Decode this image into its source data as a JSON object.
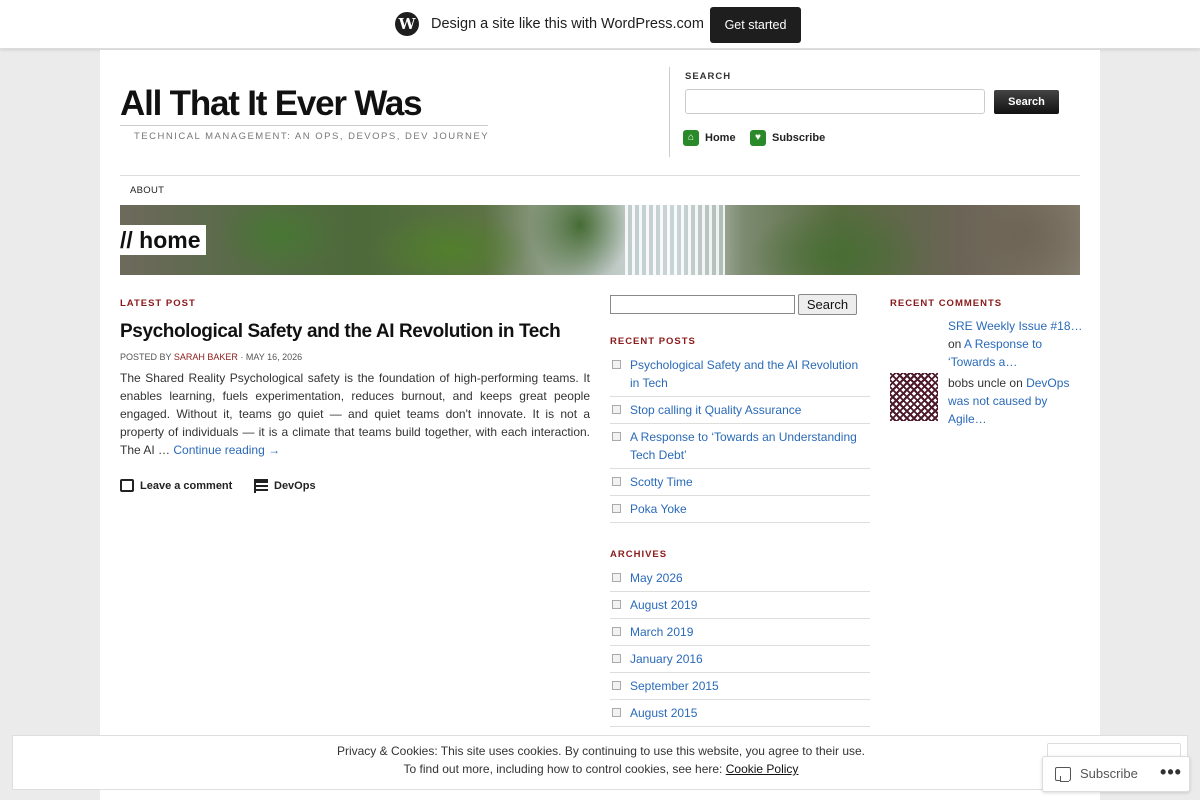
{
  "topbar": {
    "logo_glyph": "W",
    "promo_text": "Design a site like this with WordPress.com",
    "cta_label": "Get started"
  },
  "header": {
    "site_title": "All That It Ever Was",
    "tagline": "Technical Management: An Ops, DevOps, Dev Journey",
    "search_label": "SEARCH",
    "search_placeholder": "",
    "search_button": "Search",
    "quick_links": [
      {
        "label": "Home",
        "icon": "home-icon",
        "glyph": "⌂"
      },
      {
        "label": "Subscribe",
        "icon": "heart-icon",
        "glyph": "♥"
      }
    ]
  },
  "nav": {
    "items": [
      "ABOUT"
    ]
  },
  "banner": {
    "label": "// home"
  },
  "latest_post": {
    "section_label": "LATEST POST",
    "title": "Psychological Safety and the AI Revolution in Tech",
    "posted_by": "POSTED BY",
    "author": "SARAH BAKER",
    "date": "· MAY 16, 2026",
    "excerpt": "The Shared Reality Psychological safety is the foundation of high-performing teams. It enables learning, fuels experimentation, reduces burnout, and keeps great people engaged. Without it, teams go quiet — and quiet teams don't innovate. It is not a property of individuals — it is a climate that teams build together, with each interaction. The AI …",
    "continue_reading": "Continue reading →",
    "leave_comment": "Leave a comment",
    "category": "DevOps"
  },
  "sidebar_middle": {
    "search_placeholder": "",
    "search_button": "Search",
    "recent_posts_label": "RECENT POSTS",
    "recent_posts": [
      "Psychological Safety and the AI Revolution in Tech",
      "Stop calling it Quality Assurance",
      "A Response to ‘Towards an Understanding Tech Debt’",
      "Scotty Time",
      "Poka Yoke"
    ],
    "archives_label": "ARCHIVES",
    "archives": [
      "May 2026",
      "August 2019",
      "March 2019",
      "January 2016",
      "September 2015",
      "August 2015"
    ]
  },
  "sidebar_right": {
    "recent_comments_label": "RECENT COMMENTS",
    "comments": [
      {
        "author": "SRE Weekly Issue #18…",
        "on": "on",
        "post": "A Response to ‘Towards a…"
      },
      {
        "author": "bobs uncle",
        "on": "on",
        "post": "DevOps was not caused by Agile…"
      }
    ]
  },
  "cookie_banner": {
    "line1": "Privacy & Cookies: This site uses cookies. By continuing to use this website, you agree to their use.",
    "line2_prefix": "To find out more, including how to control cookies, see here:",
    "policy_link": "Cookie Policy"
  },
  "subscribe_bar": {
    "subscribe_label": "Subscribe",
    "more_label": "•••"
  },
  "colors": {
    "accent_red": "#8b1a1a",
    "link_blue": "#2a6ab8",
    "button_dark": "#111111",
    "quicklink_green": "#2a8a2a"
  }
}
